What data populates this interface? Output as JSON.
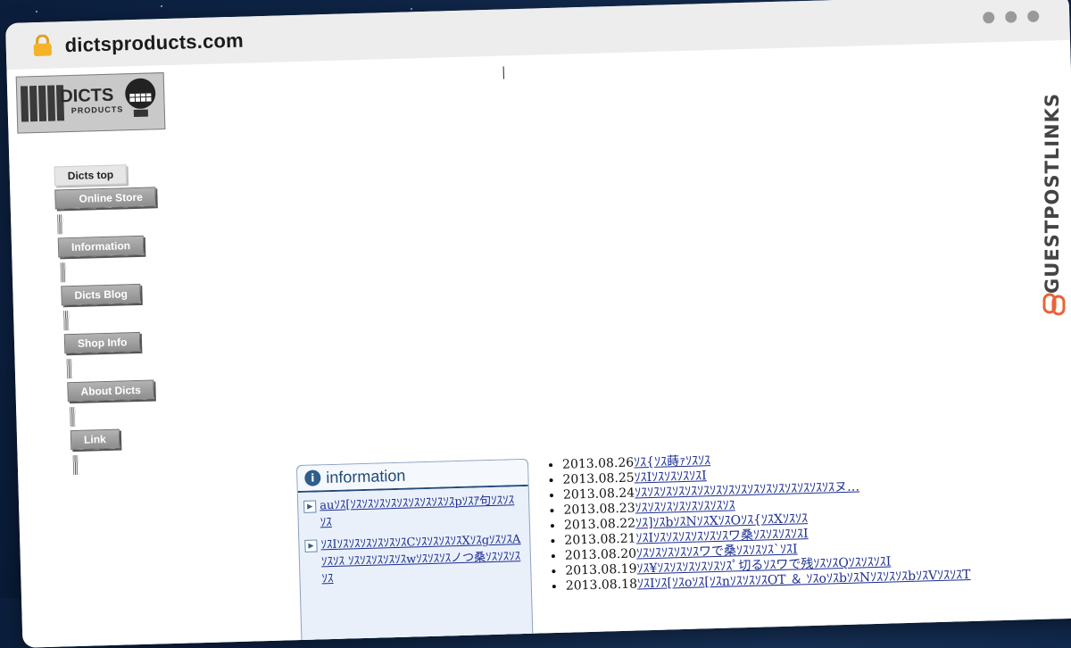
{
  "browser": {
    "url": "dictsproducts.com"
  },
  "logo": {
    "word": "DICTS",
    "sub": "PRODUCTS"
  },
  "nav": [
    {
      "label": "Dicts top"
    },
    {
      "label": "Online Store"
    },
    {
      "label": "Information"
    },
    {
      "label": "Dicts Blog"
    },
    {
      "label": "Shop Info"
    },
    {
      "label": "About Dicts"
    },
    {
      "label": "Link"
    }
  ],
  "info_box": {
    "title": "information",
    "items": [
      "auｿｽ[ｿｽｿｽｿｽｿｽｿｽｿｽｿｽｿｽｿｽpｿｽｱ句ｿｽｿｽ ｿｽ",
      "ｿｽIｿｽｿｽｿｽｿｽｿｽｿｽCｿｽｿｽｿｽｿｽXｿｽgｿｽｿｽAｿｽｿｽ ｿｽｿｽｿｽｿｽｿｽwｿｽｿｽｿｽノつ桑ｿｽｿｽｿｽｿｽ"
    ]
  },
  "news": [
    {
      "date": "2013.08.26",
      "text": "ｿｽ{ｿｽ蒔ｧｿｽｿｽ"
    },
    {
      "date": "2013.08.25",
      "text": "ｿｽIｿｽｿｽｿｽｿｽI"
    },
    {
      "date": "2013.08.24",
      "text": "ｿｽｿｽｿｽｿｽｿｽｿｽｿｽｿｽｿｽｿｽｿｽｿｽｿｽｿｽｿｽｿｽヌ…"
    },
    {
      "date": "2013.08.23",
      "text": "ｿｽｿｽｿｽｿｽｿｽｿｽｿｽｿｽ"
    },
    {
      "date": "2013.08.22",
      "text": "ｿｽ]ｿｽbｿｽNｿｽXｿｽOｿｽ{ｿｽXｿｽｿｽ"
    },
    {
      "date": "2013.08.21",
      "text": "ｿｽIｿｽｿｽｿｽｿｽｿｽｿｽワ桑ｿｽｿｽｿｽｿｽI"
    },
    {
      "date": "2013.08.20",
      "text": "ｿｽｿｽｿｽｿｽｿｽワで桑ｿｽｿｽｿｽ`ｿｽI"
    },
    {
      "date": "2013.08.19",
      "text": "ｿｽ¥ｿｽｿｽｿｽｿｽｿｽｿｽﾟ切るｿｽワで残ｿｽｿｽQｿｽｿｽｿｽI"
    },
    {
      "date": "2013.08.18",
      "text": "ｿｽIｿｽ[ｿｽoｿｽ[ｿｽnｿｽｿｽｿｽOT ＆ ｿｽoｿｽbｿｽNｿｽｿｽｿｽbｿｽVｿｽｿｽT"
    }
  ],
  "badge": {
    "text": "GUESTPOSTLINKS"
  }
}
